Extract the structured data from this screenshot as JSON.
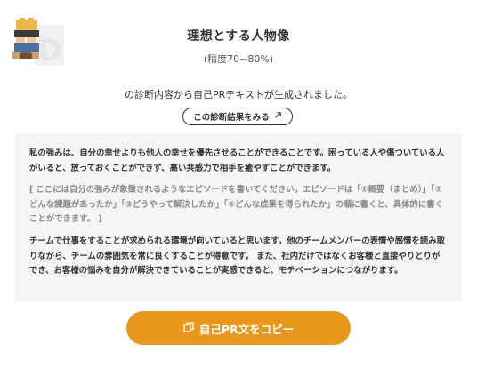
{
  "header": {
    "title": "理想とする人物像",
    "subtitle": "(精度70~80%)"
  },
  "description": "の診断内容から自己PRテキストが生成されました。",
  "result_button": {
    "label": "この診断結果をみる",
    "icon": "external-link-icon"
  },
  "pr_text": {
    "paragraph1": "私の強みは、自分の幸せよりも他人の幸せを優先させることができることです。困っている人や傷ついている人がいると、放っておくことができず、高い共感力で相手を癒やすことができます。",
    "paragraph2": "[ ここには自分の強みが象徴されるようなエピソードを書いてください。エピソードは「①概要（まとめ）」「②どんな課題があったか」「③どうやって解決したか」「④どんな成果を得られたか」の順に書くと、具体的に書くことができます。 ]",
    "paragraph3": "チームで仕事をすることが求められる環境が向いていると思います。他のチームメンバーの表情や感情を読み取りながら、チームの雰囲気を常に良くすることが得意です。 また、社内だけではなくお客様と直接やりとりができ、お客様の悩みを自分が解決できていることが実感できると、モチベーションにつながります。"
  },
  "copy_button": {
    "label": "自己PR文をコピー",
    "icon": "copy-icon"
  },
  "colors": {
    "accent": "#e8971a",
    "box_bg": "#f5f5f5",
    "placeholder_text": "#8a8a8a"
  }
}
